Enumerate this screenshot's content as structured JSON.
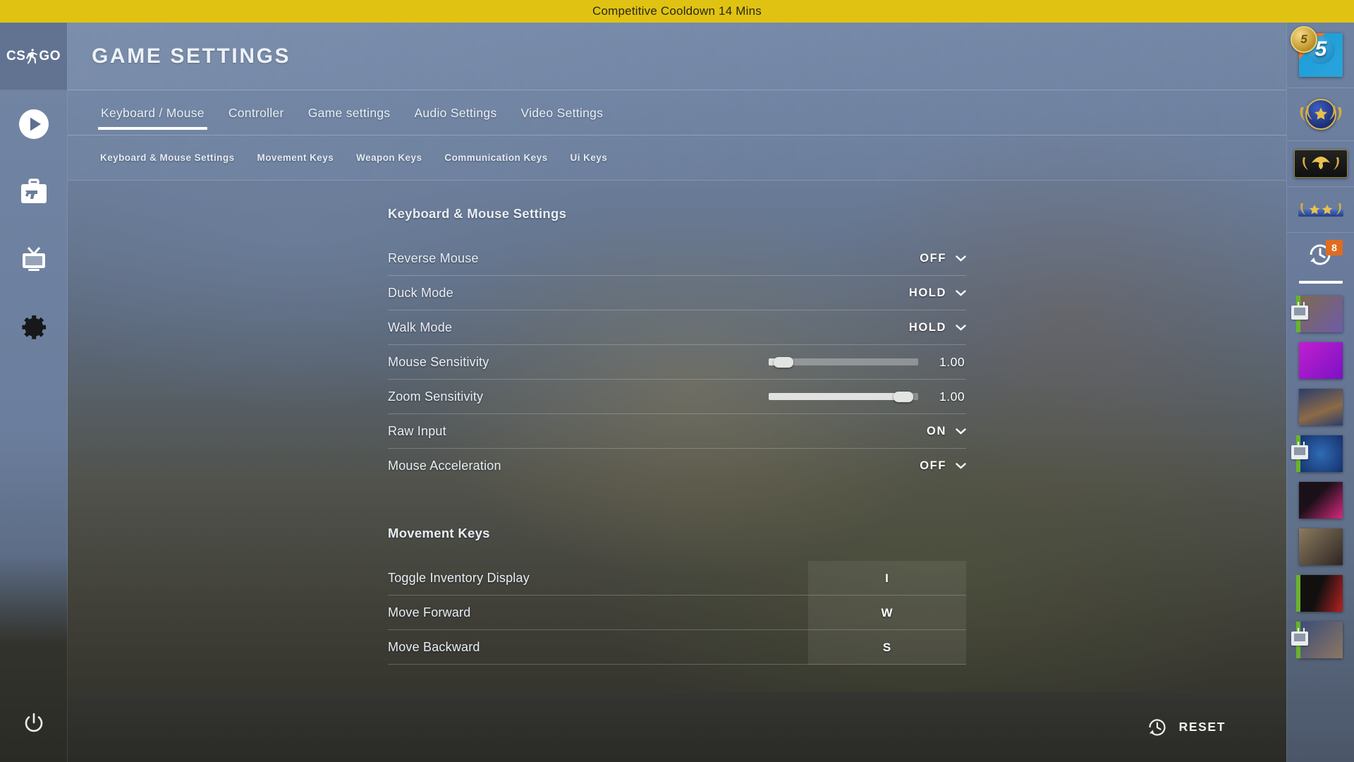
{
  "banner": {
    "text": "Competitive Cooldown 14 Mins",
    "color": "#e0c312"
  },
  "header": {
    "title": "GAME SETTINGS",
    "logo": "CS:GO"
  },
  "sidebar": {
    "items": [
      {
        "name": "play-icon",
        "label": "Play"
      },
      {
        "name": "inventory-icon",
        "label": "Inventory"
      },
      {
        "name": "watch-icon",
        "label": "Watch"
      },
      {
        "name": "settings-icon",
        "label": "Settings"
      }
    ],
    "power_label": "Quit"
  },
  "tabs": [
    {
      "label": "Keyboard / Mouse",
      "active": true
    },
    {
      "label": "Controller",
      "active": false
    },
    {
      "label": "Game settings",
      "active": false
    },
    {
      "label": "Audio Settings",
      "active": false
    },
    {
      "label": "Video Settings",
      "active": false
    }
  ],
  "subtabs": [
    {
      "label": "Keyboard & Mouse Settings"
    },
    {
      "label": "Movement Keys"
    },
    {
      "label": "Weapon Keys"
    },
    {
      "label": "Communication Keys"
    },
    {
      "label": "Ui Keys"
    }
  ],
  "sections": [
    {
      "title": "Keyboard & Mouse Settings",
      "rows": [
        {
          "type": "dropdown",
          "label": "Reverse Mouse",
          "value": "OFF"
        },
        {
          "type": "dropdown",
          "label": "Duck Mode",
          "value": "HOLD"
        },
        {
          "type": "dropdown",
          "label": "Walk Mode",
          "value": "HOLD"
        },
        {
          "type": "slider",
          "label": "Mouse Sensitivity",
          "value": "1.00",
          "percent": 4
        },
        {
          "type": "slider",
          "label": "Zoom Sensitivity",
          "value": "1.00",
          "percent": 96
        },
        {
          "type": "dropdown",
          "label": "Raw Input",
          "value": "ON"
        },
        {
          "type": "dropdown",
          "label": "Mouse Acceleration",
          "value": "OFF"
        }
      ]
    },
    {
      "title": "Movement Keys",
      "rows": [
        {
          "type": "key",
          "label": "Toggle Inventory Display",
          "value": "I"
        },
        {
          "type": "key",
          "label": "Move Forward",
          "value": "W"
        },
        {
          "type": "key",
          "label": "Move Backward",
          "value": "S"
        }
      ]
    }
  ],
  "bottom": {
    "reset_label": "RESET"
  },
  "rightpanel": {
    "profile": {
      "level": "5",
      "avatar_number": "5"
    },
    "history_count": "8",
    "friends": [
      {
        "name": "friend-avatar-1",
        "online": true,
        "watching": true,
        "c1": "#7d6a52",
        "c2": "#6e5ba8"
      },
      {
        "name": "friend-avatar-2",
        "online": false,
        "watching": false,
        "c1": "#c11fd0",
        "c2": "#7a12c4"
      },
      {
        "name": "friend-avatar-3",
        "online": false,
        "watching": false,
        "c1": "#2b3d6d",
        "c2": "#8c6a46"
      },
      {
        "name": "friend-avatar-4",
        "online": true,
        "watching": true,
        "c1": "#15306b",
        "c2": "#2f6bb5"
      },
      {
        "name": "friend-avatar-5",
        "online": false,
        "watching": false,
        "c1": "#1a1118",
        "c2": "#d8287e"
      },
      {
        "name": "friend-avatar-6",
        "online": false,
        "watching": false,
        "c1": "#8b7a5e",
        "c2": "#2e2622"
      },
      {
        "name": "friend-avatar-7",
        "online": true,
        "watching": false,
        "c1": "#12100f",
        "c2": "#b42222"
      },
      {
        "name": "friend-avatar-8",
        "online": true,
        "watching": true,
        "c1": "#3a4d78",
        "c2": "#8d7662"
      }
    ]
  }
}
